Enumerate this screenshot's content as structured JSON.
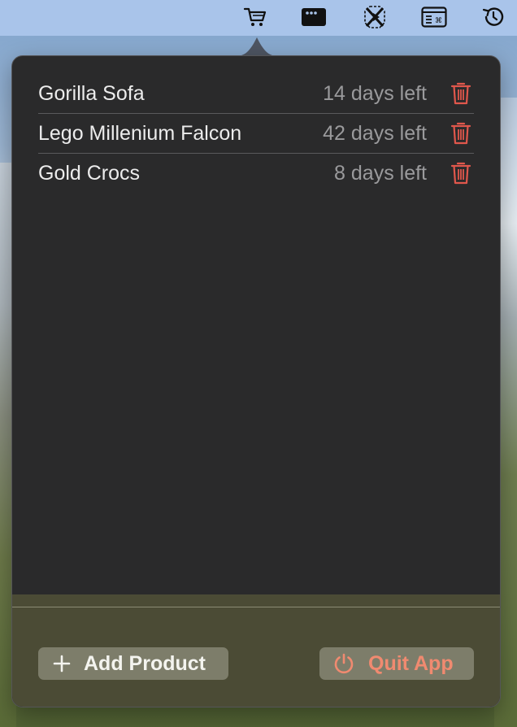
{
  "menubar": {
    "icons": [
      "cart-icon",
      "window-dots-icon",
      "cursor-app-icon",
      "window-command-icon",
      "time-machine-icon"
    ]
  },
  "products": [
    {
      "name": "Gorilla Sofa",
      "days_left": "14 days left"
    },
    {
      "name": "Lego Millenium Falcon",
      "days_left": "42 days left"
    },
    {
      "name": "Gold Crocs",
      "days_left": "8 days left"
    }
  ],
  "footer": {
    "add_label": "Add Product",
    "quit_label": "Quit App"
  },
  "colors": {
    "popover_bg": "#2a2a2b",
    "footer_bg": "#4b4b35",
    "trash": "#e0574c",
    "quit_text": "#f08a70",
    "menubar_bg": "#a9c4ea"
  }
}
